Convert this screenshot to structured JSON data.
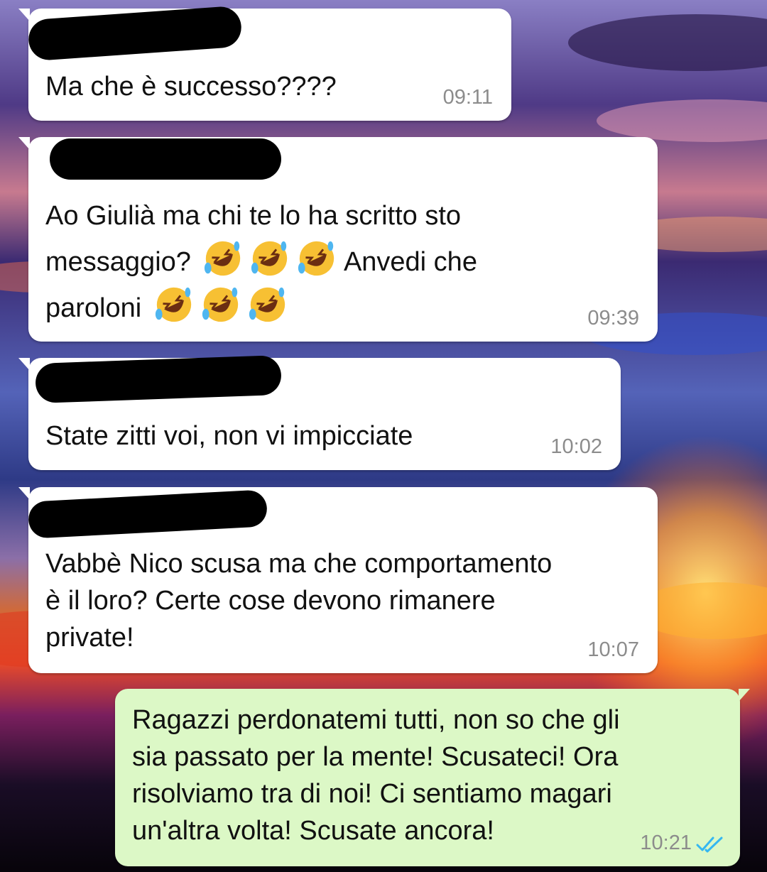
{
  "chat": {
    "messages": [
      {
        "direction": "incoming",
        "sender_redacted": true,
        "text": "Ma che è successo????",
        "time": "09:11"
      },
      {
        "direction": "incoming",
        "sender_redacted": true,
        "text_line1": "Ao Giulià ma chi te lo ha scritto sto",
        "text_line2a": "messaggio?",
        "text_line2b": "Anvedi che",
        "text_line3": "paroloni",
        "time": "09:39",
        "emoji": "rolling-on-floor-laughing"
      },
      {
        "direction": "incoming",
        "sender_redacted": true,
        "text": "State zitti voi, non vi impicciate",
        "time": "10:02"
      },
      {
        "direction": "incoming",
        "sender_redacted": true,
        "text": "Vabbè Nico scusa ma che comportamento\nè il loro? Certe cose devono rimanere\nprivate!",
        "time": "10:07"
      },
      {
        "direction": "outgoing",
        "text": "Ragazzi perdonatemi tutti, non so che gli\nsia passato per la mente! Scusateci! Ora\nrisolviamo tra di noi! Ci sentiamo magari\nun'altra volta! Scusate ancora!",
        "time": "10:21",
        "status": "read"
      }
    ]
  },
  "colors": {
    "incoming_bubble": "#ffffff",
    "outgoing_bubble": "#dcf8c6",
    "timestamp": "#8c8c8c",
    "read_ticks": "#34b7f1"
  },
  "icons": [
    "rolling-on-floor-laughing-emoji",
    "double-check-icon"
  ]
}
